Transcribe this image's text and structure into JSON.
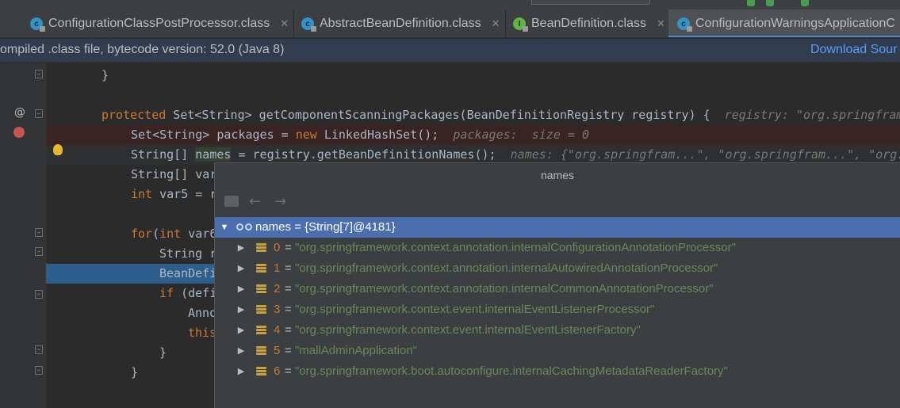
{
  "tabs": [
    {
      "label": "ConfigurationClassPostProcessor.class",
      "icon": "class-icon"
    },
    {
      "label": "AbstractBeanDefinition.class",
      "icon": "class-icon"
    },
    {
      "label": "BeanDefinition.class",
      "icon": "interface-icon"
    },
    {
      "label": "ConfigurationWarningsApplicationC",
      "icon": "class-icon",
      "active": true
    }
  ],
  "notice": {
    "text": "ompiled .class file, bytecode version: 52.0 (Java 8)",
    "link": "Download Sour"
  },
  "code": {
    "l1": "}",
    "l2": {
      "kw": "protected",
      "rest": " Set<String> getComponentScanningPackages(BeanDefinitionRegistry registry) {",
      "hint": "registry: \"org.springfram"
    },
    "l3": {
      "pre": "Set<String> packages = ",
      "kw": "new",
      "rest": " LinkedHashSet();",
      "hint": "packages:  size = 0"
    },
    "l4": {
      "pre": "String[] ",
      "word": "names",
      "rest": " = registry.getBeanDefinitionNames();",
      "hint": "names: {\"org.springfram...\", \"org.springfram...\", \"org.sp"
    },
    "l5": "String[] var",
    "l6": {
      "kw": "int",
      "rest": " var5 = r"
    },
    "l7": {
      "kw": "for",
      "rest": "(",
      "kw2": "int",
      "rest2": " var6"
    },
    "l8": "String r",
    "l9": "BeanDefi",
    "l10": {
      "kw": "if",
      "rest": " (defi"
    },
    "l11": "Anno",
    "l12": {
      "kw": "this"
    },
    "l13": "}",
    "l14": "}"
  },
  "popup": {
    "title": "names",
    "root": "names = {String[7]@4181}",
    "items": [
      {
        "index": "0",
        "value": "\"org.springframework.context.annotation.internalConfigurationAnnotationProcessor\""
      },
      {
        "index": "1",
        "value": "\"org.springframework.context.annotation.internalAutowiredAnnotationProcessor\""
      },
      {
        "index": "2",
        "value": "\"org.springframework.context.annotation.internalCommonAnnotationProcessor\""
      },
      {
        "index": "3",
        "value": "\"org.springframework.context.event.internalEventListenerProcessor\""
      },
      {
        "index": "4",
        "value": "\"org.springframework.context.event.internalEventListenerFactory\""
      },
      {
        "index": "5",
        "value": "\"mallAdminApplication\""
      },
      {
        "index": "6",
        "value": "\"org.springframework.boot.autoconfigure.internalCachingMetadataReaderFactory\""
      }
    ],
    "equals": "="
  },
  "gutter": {
    "override_marker": "@"
  },
  "colors": {
    "keyword": "#cc7832",
    "string": "#6a8759",
    "selection": "#4b6eaf",
    "execution_line": "#2d5e8c",
    "link": "#589df6"
  }
}
